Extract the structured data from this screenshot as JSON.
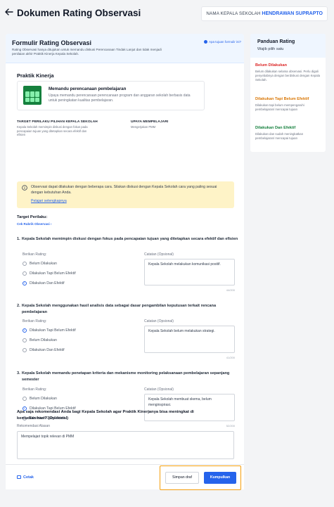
{
  "header": {
    "title": "Dokumen Rating Observasi",
    "kepsek_label": "NAMA KEPALA SEKOLAH",
    "kepsek_name": "HENDRAWAN SUPRAPTO"
  },
  "form": {
    "title": "Formulir Rating Observasi",
    "description": "Rating Observasi hanya ditujukan untuk memandu diskusi Perencanaan Tindak Lanjut dan tidak menjadi penilaian akhir Praktik Kinerja Kepala Sekolah.",
    "tujuan_link": "Apa tujuan formulir ini?",
    "section_title": "Praktik Kinerja",
    "competency": {
      "title": "Memandu perencanaan pembelajaran",
      "description": "Upaya memandu perencanaan perencanaan program dan anggaran sekolah berbasis data untuk peningkatan kualitas pembelajaran."
    },
    "target_label": "TARGET PERILAKU PILIHAN KEPALA SEKOLAH",
    "target_text": "Kepala Sekolah memimpin diskusi dengan fokus pada pencapaian tujuan yang ditetapkan secara efektif dan efisien",
    "upaya_label": "UPAYA MEMPELAJARI",
    "upaya_text": "Mengerjakan PMM",
    "notice_text": "Observasi dapat dilakukan dengan beberapa cara. Silakan diskusi dengan Kepala Sekolah cara yang paling sesuai dengan kebutuhan Anda.",
    "notice_link": "Pelajari selengkapnya",
    "target_title": "Target Perilaku:",
    "rubrik_link": "Cek Rubrik Observasi",
    "rating_label": "Berikan Rating:",
    "catatan_label": "Catatan (Opsional)",
    "questions": [
      {
        "num": "1.",
        "text": "Kepala Sekolah memimpin diskusi dengan fokus pada pencapaian tujuan yang ditetapkan secara efektif dan efisien",
        "options": [
          "Belum Dilakukan",
          "Dilakukan Tapi Belum Efektif",
          "Dilakukan Dan Efektif"
        ],
        "selected": 2,
        "note": "Kepala Sekolah melakukan komunikasi positif.",
        "counter": "44/200"
      },
      {
        "num": "2.",
        "text": "Kepala Sekolah menggunakan hasil analisis data sebagai dasar pengambilan keputusan terkait rencana pembelajaran",
        "options": [
          "Dilakukan Tapi Belum Efektif",
          "Belum Dilakukan",
          "Dilakukan Dan Efektif"
        ],
        "selected": 0,
        "note": "Kepala Sekolah belum melakukan strategi.",
        "counter": "41/200"
      },
      {
        "num": "3.",
        "text": "Kepala Sekolah memandu penetapan kriteria dan mekanisme monitoring pelaksanaan pembelajaran sepanjang semester",
        "options": [
          "Belum Dilakukan",
          "Dilakukan Tapi Belum Efektif",
          "Dilakukan Dan Efektif"
        ],
        "selected": 1,
        "note": "Kepala Sekolah membuat skema, belum menginspirasi.",
        "counter": "52/200"
      }
    ],
    "reco_title": "Apa saja rekomendasi Anda bagi Kepala Sekolah agar Praktik Kinerjanya bisa meningkat di kemudian hari? (Opsional)",
    "reco_label": "Rekomendasi Alasan",
    "reco_value": "Mempelajari topik relevan di PMM"
  },
  "footer": {
    "print_label": "Cetak",
    "draft_label": "Simpan draf",
    "submit_label": "Kumpulkan"
  },
  "guide": {
    "title": "Panduan Rating",
    "subtitle": "Wajib pilih satu",
    "items": [
      {
        "heading": "Belum Dilakukan",
        "text": "Belum dilakukan selama observasi. Perlu digali penyebabnya dengan berdiskusi dengan Kepala Sekolah.",
        "color": "#dc2626"
      },
      {
        "heading": "Dilakukan Tapi Belum Efektif",
        "text": "Dilakukan tapi belum mempengaruhi pembelajaran/ mencapai tujuan",
        "color": "#d97706"
      },
      {
        "heading": "Dilakukan Dan Efektif",
        "text": "Dilakukan dan sudah meningkatkan pembelajaran/ mencapai tujuan",
        "color": "#15803d"
      }
    ]
  },
  "colors": {
    "accent": "#2563eb",
    "notice_bg": "#fef3c7",
    "highlight": "#f59e0b"
  }
}
